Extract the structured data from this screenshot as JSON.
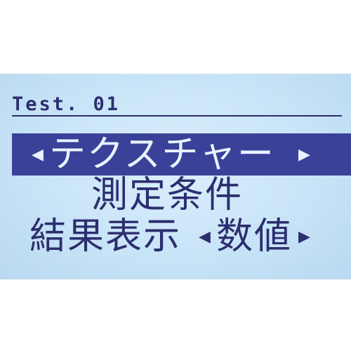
{
  "screen": {
    "title": "Test. 01",
    "menu": {
      "selected_item": "テクスチャー",
      "item_2": "測定条件",
      "item_3_label": "結果表示",
      "item_3_value": "数値"
    },
    "icons": {
      "left_arrow": "◀",
      "right_arrow": "▶"
    },
    "colors": {
      "lcd_background": "#c4e2f7",
      "text": "#2c2e6e",
      "highlight_bar": "#3a4199",
      "highlight_text": "#e9f3ff"
    }
  }
}
